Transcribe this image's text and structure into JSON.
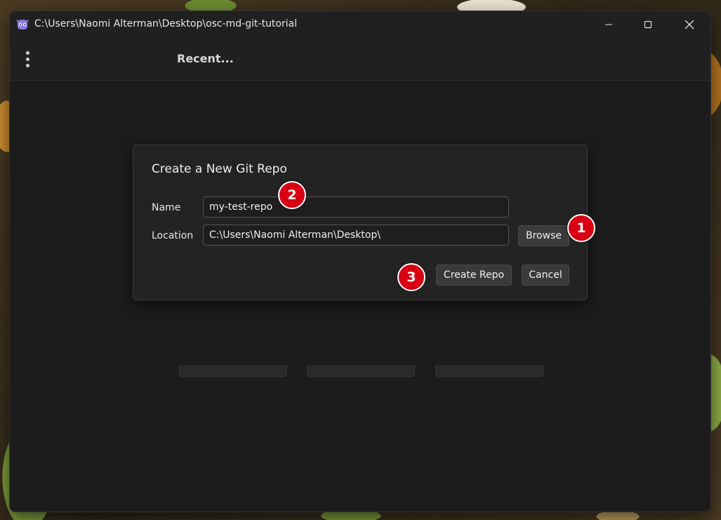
{
  "window": {
    "title": "C:\\Users\\Naomi Alterman\\Desktop\\osc-md-git-tutorial",
    "icon": "app-logo-icon"
  },
  "toolbar": {
    "menu_icon": "kebab-menu-icon",
    "recent_label": "Recent..."
  },
  "dialog": {
    "title": "Create a New Git Repo",
    "name_label": "Name",
    "name_value": "my-test-repo",
    "location_label": "Location",
    "location_value": "C:\\Users\\Naomi Alterman\\Desktop\\",
    "browse_label": "Browse",
    "create_label": "Create Repo",
    "cancel_label": "Cancel"
  },
  "annotations": [
    {
      "number": "1",
      "target": "Browse"
    },
    {
      "number": "2",
      "target": "Name"
    },
    {
      "number": "3",
      "target": "Create Repo"
    }
  ],
  "colors": {
    "badge": "#d80012",
    "window_bg": "#1c1c1c",
    "dialog_bg": "#232323"
  }
}
